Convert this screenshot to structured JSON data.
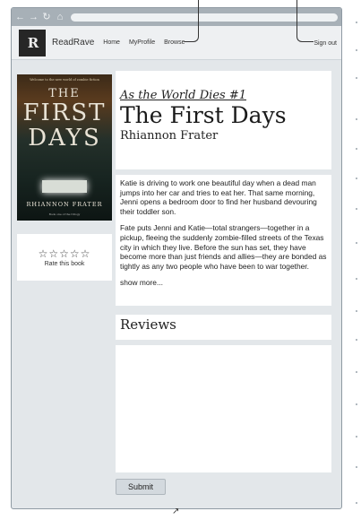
{
  "browser": {
    "back_icon": "arrow-left-icon",
    "forward_icon": "arrow-right-icon",
    "reload_icon": "reload-icon",
    "home_icon": "home-icon"
  },
  "header": {
    "logo_text": "R",
    "brand": "ReadRave",
    "nav": [
      "Home",
      "MyProfile",
      "Browse"
    ],
    "sign_out": "Sign out"
  },
  "book": {
    "cover": {
      "small_text": "Welcome to the new world of zombie fiction",
      "title_line1": "THE",
      "title_line2": "FIRST",
      "title_line3": "DAYS",
      "author": "RHIANNON FRATER",
      "tagline": "Book one of the trilogy"
    },
    "series": "As the World Dies #1",
    "title": "The First Days",
    "author": "Rhiannon Frater",
    "description": [
      "Katie is driving to work one beautiful day when a dead man jumps into her car and tries to eat her. That same morning, Jenni opens a bedroom door to find her husband devouring their toddler son.",
      "Fate puts Jenni and Katie—total strangers—together in a pickup, fleeing the suddenly zombie-filled streets of the Texas city in which they live. Before the sun has set, they have become more than just friends and allies—they are bonded as tightly as any two people who have been to war together."
    ],
    "show_more": "show more..."
  },
  "rating": {
    "stars": "☆☆☆☆☆",
    "label": "Rate this book"
  },
  "reviews": {
    "heading": "Reviews",
    "input_value": "",
    "submit_label": "Submit"
  }
}
